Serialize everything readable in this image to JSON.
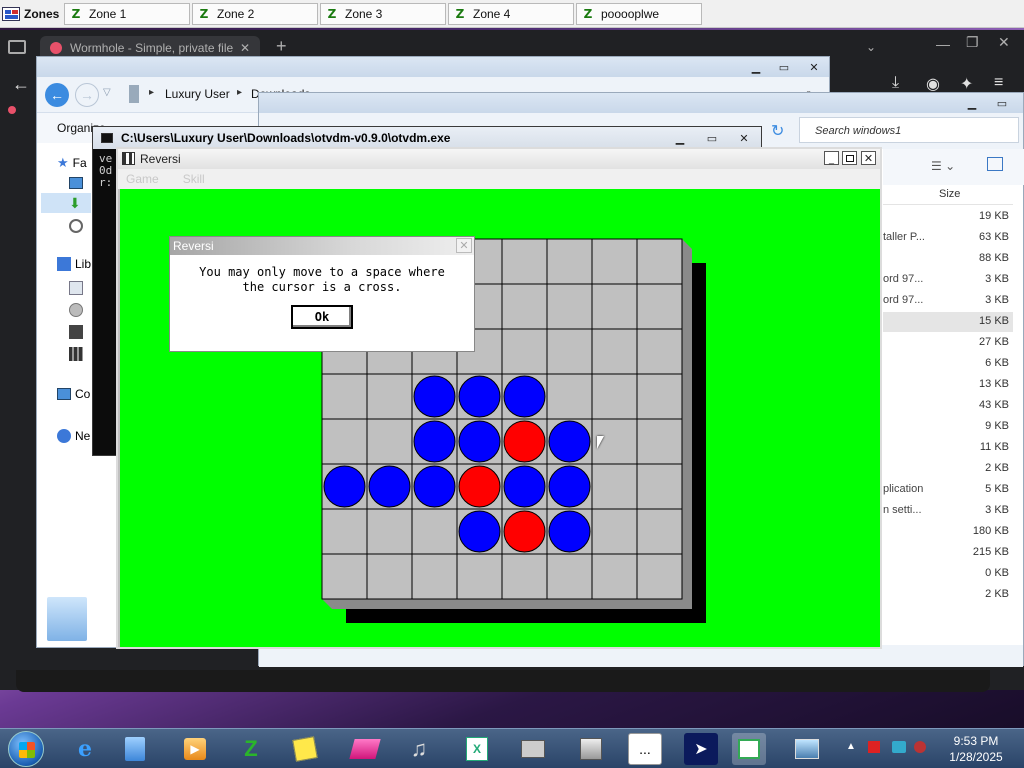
{
  "zones_bar": {
    "label": "Zones",
    "zones": [
      "Zone 1",
      "Zone 2",
      "Zone 3",
      "Zone 4",
      "pooooplwe"
    ]
  },
  "browser": {
    "tab_title": "Wormhole - Simple, private file s",
    "search_text": "Search windows1"
  },
  "explorer": {
    "breadcrumb_user": "Luxury User",
    "breadcrumb_next": "Downloads",
    "organize_label": "Organize",
    "nav_favorites": "Fa",
    "nav_libraries": "Lib",
    "nav_computer": "Co",
    "nav_network": "Ne",
    "size_header": "Size",
    "sizes": [
      "19 KB",
      "63 KB",
      "88 KB",
      "3 KB",
      "3 KB",
      "15 KB",
      "27 KB",
      "6 KB",
      "13 KB",
      "43 KB",
      "9 KB",
      "11 KB",
      "2 KB",
      "5 KB",
      "3 KB",
      "180 KB",
      "215 KB",
      "0 KB",
      "2 KB"
    ],
    "name_fragments": [
      "taller P...",
      "ord 97...",
      "ord 97...",
      "plication",
      "n setti..."
    ]
  },
  "console": {
    "title": "C:\\Users\\Luxury User\\Downloads\\otvdm-v0.9.0\\otvdm.exe",
    "lines": [
      "ve",
      "0d",
      "r:"
    ]
  },
  "reversi": {
    "title": "Reversi",
    "menu": [
      "Game",
      "Skill"
    ],
    "board": [
      "........",
      "........",
      "........",
      "..BBB...",
      "..BBRB..",
      "BBBRBB..",
      "...BRB..",
      "........"
    ],
    "colors": {
      "green": "#00ff00",
      "blue": "#0000ff",
      "red": "#ff0000"
    }
  },
  "dialog": {
    "title": "Reversi",
    "message": "You may only move to a space where\nthe cursor is a cross.",
    "ok_label": "Ok"
  },
  "taskbar": {
    "time": "9:53 PM",
    "date": "1/28/2025"
  }
}
